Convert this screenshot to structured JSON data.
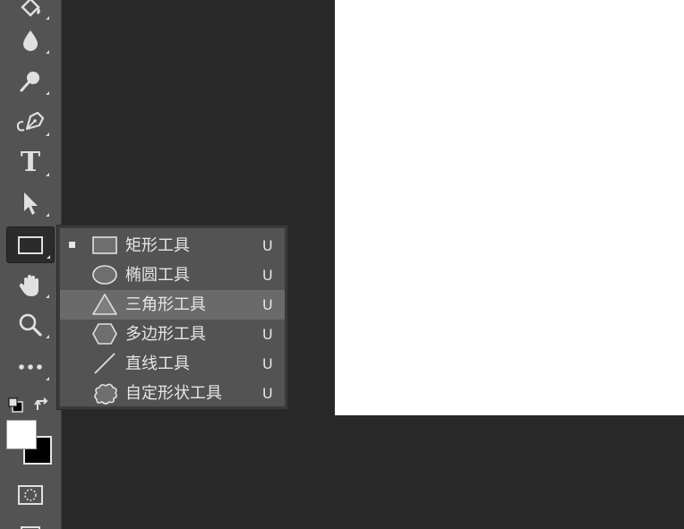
{
  "toolbar": {
    "tools": [
      {
        "name": "paint-bucket",
        "icon": "paint-bucket-icon"
      },
      {
        "name": "blur",
        "icon": "drop-icon"
      },
      {
        "name": "dodge",
        "icon": "dodge-icon"
      },
      {
        "name": "pen",
        "icon": "pen-icon"
      },
      {
        "name": "type",
        "icon": "type-icon",
        "glyph": "T"
      },
      {
        "name": "path-selection",
        "icon": "arrow-icon"
      },
      {
        "name": "rectangle",
        "icon": "rectangle-icon",
        "active": true
      },
      {
        "name": "hand",
        "icon": "hand-icon"
      },
      {
        "name": "zoom",
        "icon": "zoom-icon"
      },
      {
        "name": "more",
        "icon": "ellipsis-icon",
        "glyph": "•••"
      }
    ],
    "foreground_color": "#ffffff",
    "background_color": "#000000"
  },
  "flyout": {
    "items": [
      {
        "label": "矩形工具",
        "shortcut": "U",
        "icon": "rectangle-icon",
        "selected": true
      },
      {
        "label": "椭圆工具",
        "shortcut": "U",
        "icon": "ellipse-icon"
      },
      {
        "label": "三角形工具",
        "shortcut": "U",
        "icon": "triangle-icon",
        "hovered": true
      },
      {
        "label": "多边形工具",
        "shortcut": "U",
        "icon": "polygon-icon"
      },
      {
        "label": "直线工具",
        "shortcut": "U",
        "icon": "line-icon"
      },
      {
        "label": "自定形状工具",
        "shortcut": "U",
        "icon": "custom-shape-icon"
      }
    ]
  },
  "colors": {
    "toolbar_bg": "#535353",
    "workspace_bg": "#282828",
    "document_bg": "#ffffff",
    "menu_hover": "#6a6a6a"
  }
}
